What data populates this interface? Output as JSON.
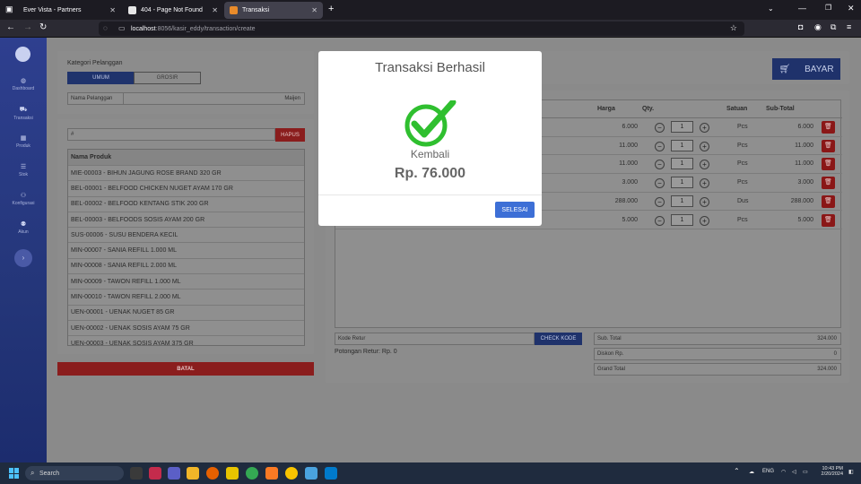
{
  "browser": {
    "tabs": [
      {
        "label": "Ever Vista - Partners",
        "active": false,
        "icon": "document-icon"
      },
      {
        "label": "404 - Page Not Found",
        "active": false,
        "icon": "laravel-icon"
      },
      {
        "label": "Transaksi",
        "active": true,
        "icon": "app-icon"
      }
    ],
    "new_tab": "+",
    "url_host": "localhost",
    "url_path": ":8056/kasir_eddy/transaction/create"
  },
  "sidebar": {
    "items": [
      {
        "label": "Dashboard",
        "icon": "dashboard-icon"
      },
      {
        "label": "Transaksi",
        "icon": "cart-icon"
      },
      {
        "label": "Produk",
        "icon": "box-icon"
      },
      {
        "label": "Stok",
        "icon": "layers-icon"
      },
      {
        "label": "Konfigurasi",
        "icon": "users-icon"
      },
      {
        "label": "Akun",
        "icon": "user-icon"
      }
    ]
  },
  "customer": {
    "category_label": "Kategori Pelanggan",
    "options": [
      "UMUM",
      "GROSIR"
    ],
    "selected": "UMUM",
    "name_label": "Nama Pelanggan",
    "name_value": "Maijen"
  },
  "product_search": {
    "value": "#",
    "clear_label": "HAPUS"
  },
  "product_list": {
    "header": "Nama Produk",
    "items": [
      "MIE-00003 - BIHUN JAGUNG ROSE BRAND 320 GR",
      "BEL-00001 - BELFOOD CHICKEN NUGET AYAM 170 GR",
      "BEL-00002 - BELFOOD KENTANG STIK 200 GR",
      "BEL-00003 - BELFOODS SOSIS AYAM 200 GR",
      "SUS-00006 - SUSU BENDERA KECIL",
      "MIN-00007 - SANIA REFILL 1.000 ML",
      "MIN-00008 - SANIA REFILL 2.000 ML",
      "MIN-00009 - TAWON REFILL 1.000 ML",
      "MIN-00010 - TAWON REFILL 2.000 ML",
      "UEN-00001 - UENAK NUGET 85 GR",
      "UEN-00002 - UENAK SOSIS AYAM 75 GR",
      "UEN-00003 - UENAK SOSIS AYAM 375 GR"
    ]
  },
  "cancel_label": "BATAL",
  "pay_label": "BAYAR",
  "cart": {
    "headers": {
      "price": "Harga",
      "qty": "Qty.",
      "unit": "Satuan",
      "subtotal": "Sub-Total"
    },
    "rows": [
      {
        "price": "6.000",
        "qty": "1",
        "unit": "Pcs",
        "subtotal": "6.000"
      },
      {
        "price": "11.000",
        "qty": "1",
        "unit": "Pcs",
        "subtotal": "11.000"
      },
      {
        "price": "11.000",
        "qty": "1",
        "unit": "Pcs",
        "subtotal": "11.000"
      },
      {
        "price": "3.000",
        "qty": "1",
        "unit": "Pcs",
        "subtotal": "3.000"
      },
      {
        "price": "288.000",
        "qty": "1",
        "unit": "Dus",
        "subtotal": "288.000"
      },
      {
        "price": "5.000",
        "qty": "1",
        "unit": "Pcs",
        "subtotal": "5.000"
      }
    ]
  },
  "retur": {
    "code_label": "Kode Retur",
    "check_label": "CHECK KODE",
    "discount_text": "Potongan Retur: Rp. 0"
  },
  "totals": {
    "subtotal_label": "Sub. Total",
    "subtotal_value": "324.000",
    "discount_label": "Diskon Rp.",
    "discount_value": "0",
    "grand_label": "Grand Total",
    "grand_value": "324.000"
  },
  "modal": {
    "title": "Transaksi Berhasil",
    "change_label": "Kembali",
    "change_value": "Rp. 76.000",
    "button": "SELESAI"
  },
  "taskbar": {
    "search_placeholder": "Search",
    "lang": "ENG",
    "time": "10:43 PM",
    "date": "2/20/2024"
  },
  "colors": {
    "accent": "#3d6fd6",
    "success": "#2fbf2f",
    "danger": "#c62828",
    "sidebar": "#2e3f8f"
  }
}
